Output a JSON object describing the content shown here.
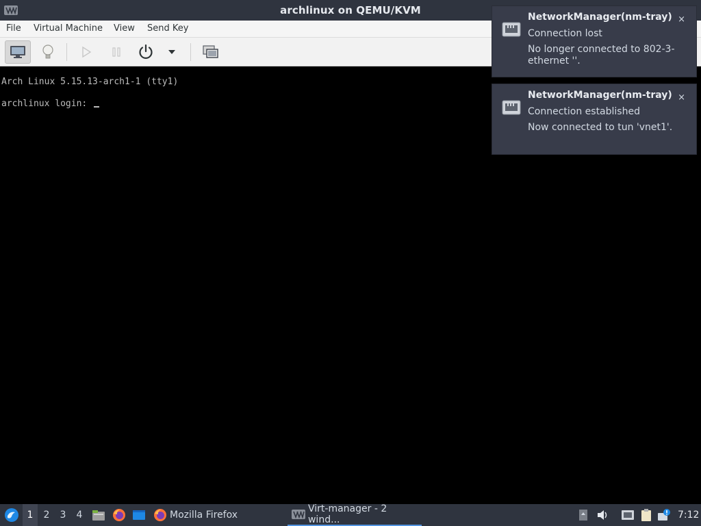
{
  "window": {
    "title": "archlinux on QEMU/KVM",
    "icon": "virt-manager-icon"
  },
  "menubar": {
    "items": [
      "File",
      "Virtual Machine",
      "View",
      "Send Key"
    ]
  },
  "toolbar": {
    "buttons": [
      "console-icon",
      "lightbulb-icon",
      "play-icon",
      "pause-icon",
      "power-icon",
      "chevron-down-icon",
      "screenshot-icon"
    ]
  },
  "console": {
    "lines": [
      "Arch Linux 5.15.13-arch1-1 (tty1)",
      "archlinux login: "
    ]
  },
  "notifications": [
    {
      "app": "NetworkManager(nm-tray)",
      "summary": "Connection lost",
      "body": "No longer connected to 802-3-ethernet ''.",
      "close": "×",
      "icon": "network-wired-icon"
    },
    {
      "app": "NetworkManager(nm-tray)",
      "summary": "Connection established",
      "body": "Now connected to tun 'vnet1'.",
      "close": "×",
      "icon": "network-wired-icon"
    }
  ],
  "taskbar": {
    "workspaces": [
      "1",
      "2",
      "3",
      "4"
    ],
    "active_workspace": "1",
    "tasks": [
      {
        "label": "Mozilla Firefox",
        "icon": "firefox-icon"
      },
      {
        "label": "Virt-manager - 2 wind...",
        "icon": "virt-manager-icon"
      }
    ],
    "clock": "7:12"
  },
  "colors": {
    "titlebar": "#2f343f",
    "notification_bg": "#383c4a",
    "accent": "#5294e2"
  }
}
